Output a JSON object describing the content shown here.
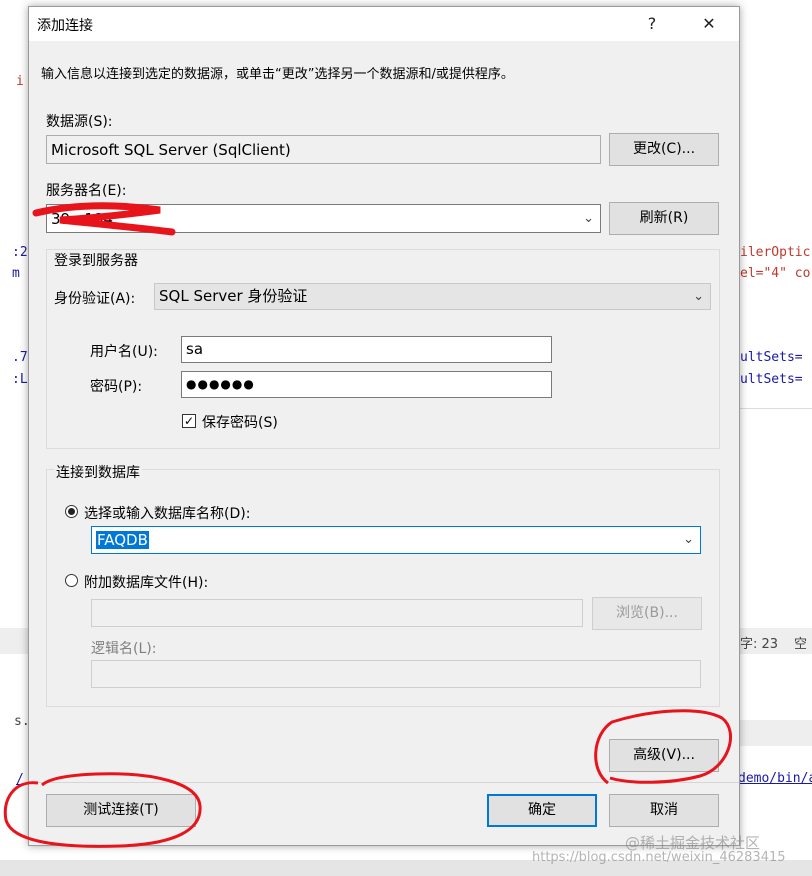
{
  "background": {
    "frag_left_1": "i",
    "frag_left_2": ":2",
    "frag_left_3": "m",
    "frag_left_4": ".7",
    "frag_left_5": ":L",
    "frag_left_6": "s.",
    "frag_left_7": "/",
    "frag_right_1": "ilerOptic",
    "frag_right_2": "el=\"4\" co",
    "frag_right_3": "ultSets=",
    "frag_right_4": "ultSets=",
    "status_col": "字: 23",
    "status_space": "空",
    "path_frag": "demo/bin/a"
  },
  "dialog": {
    "title": "添加连接",
    "help_glyph": "?",
    "close_glyph": "✕",
    "instructions": "输入信息以连接到选定的数据源，或单击“更改”选择另一个数据源和/或提供程序。",
    "datasource": {
      "label": "数据源(S):",
      "value": "Microsoft SQL Server (SqlClient)",
      "change_button": "更改(C)..."
    },
    "server": {
      "label": "服务器名(E):",
      "value": "39.      .184",
      "refresh_button": "刷新(R)"
    },
    "login_group": {
      "title": "登录到服务器",
      "auth_label": "身份验证(A):",
      "auth_value": "SQL Server 身份验证",
      "username_label": "用户名(U):",
      "username_value": "sa",
      "password_label": "密码(P):",
      "password_value": "●●●●●●",
      "save_password_label": "保存密码(S)",
      "save_password_checked": "✓"
    },
    "db_group": {
      "title": "连接到数据库",
      "select_db_label": "选择或输入数据库名称(D):",
      "db_value": "FAQDB",
      "attach_label": "附加数据库文件(H):",
      "browse_button": "浏览(B)...",
      "logical_name_label": "逻辑名(L):"
    },
    "advanced_button": "高级(V)...",
    "test_button": "测试连接(T)",
    "ok_button": "确定",
    "cancel_button": "取消"
  },
  "watermark": {
    "brand": "@稀土掘金技术社区",
    "url": "https://blog.csdn.net/weixin_46283415"
  },
  "colors": {
    "accent": "#0078d7",
    "annotation": "#e8141c"
  }
}
